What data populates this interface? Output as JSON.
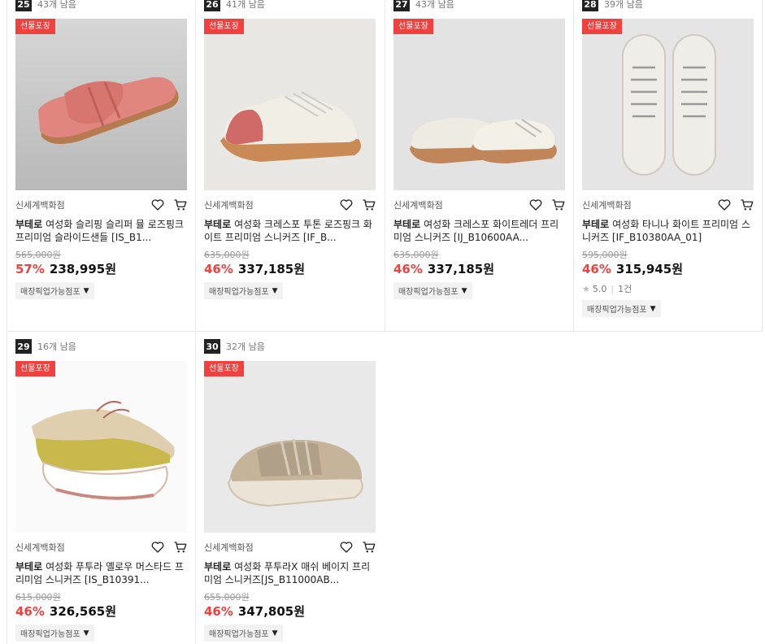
{
  "products": [
    {
      "rank": "25",
      "stock": "43개 남음",
      "badge": "선물포장",
      "store": "신세계백화점",
      "brand": "부테로",
      "name": "여성화 슬리핑 슬리퍼 뮬 로즈핑크 프리미엄 슬라이드샌들 [IS_B1...",
      "original": "565,000원",
      "discount": "57%",
      "price": "238,995원",
      "pickup": "매장픽업가능점포",
      "image": "pink-slide-sandal"
    },
    {
      "rank": "26",
      "stock": "41개 남음",
      "badge": "선물포장",
      "store": "신세계백화점",
      "brand": "부테로",
      "name": "여성화 크레스포 투톤 로즈핑크 화이트 프리미엄 스니커즈 [IF_B...",
      "original": "635,000원",
      "discount": "46%",
      "price": "337,185원",
      "pickup": "매장픽업가능점포",
      "image": "pink-white-sneaker"
    },
    {
      "rank": "27",
      "stock": "43개 남음",
      "badge": "선물포장",
      "store": "신세계백화점",
      "brand": "부테로",
      "name": "여성화 크레스포 화이트레더 프리미엄 스니커즈 [IJ_B10600AA...",
      "original": "635,000원",
      "discount": "46%",
      "price": "337,185원",
      "pickup": "매장픽업가능점포",
      "image": "white-leather-sneaker"
    },
    {
      "rank": "28",
      "stock": "39개 남음",
      "badge": "선물포장",
      "store": "신세계백화점",
      "brand": "부테로",
      "name": "여성화 타니나 화이트 프리미엄 스니커즈 [IF_B10380AA_01]",
      "original": "595,000원",
      "discount": "46%",
      "price": "315,945원",
      "rating": "5.0",
      "reviews": "1건",
      "pickup": "매장픽업가능점포",
      "image": "white-lace-sneaker"
    },
    {
      "rank": "29",
      "stock": "16개 남음",
      "badge": "선물포장",
      "store": "신세계백화점",
      "brand": "부테로",
      "name": "여성화 푸투라 옐로우 머스타드 프리미엄 스니커즈 [IS_B10391...",
      "original": "615,000원",
      "discount": "46%",
      "price": "326,565원",
      "pickup": "매장픽업가능점포",
      "image": "yellow-runner"
    },
    {
      "rank": "30",
      "stock": "32개 남음",
      "badge": "선물포장",
      "store": "신세계백화점",
      "brand": "부테로",
      "name": "여성화 푸투라X 매쉬 베이지 프리미엄 스니커즈[JS_B11000AB...",
      "original": "655,000원",
      "discount": "46%",
      "price": "347,805원",
      "pickup": "매장픽업가능점포",
      "image": "beige-mesh-runner"
    }
  ]
}
